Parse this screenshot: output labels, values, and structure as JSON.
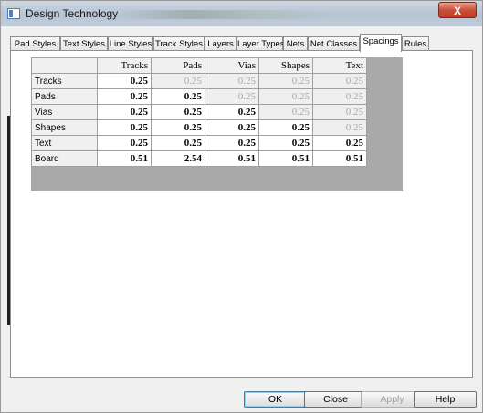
{
  "window": {
    "title": "Design Technology",
    "close_label": "X"
  },
  "tabs": [
    {
      "label": "Pad Styles",
      "active": false
    },
    {
      "label": "Text Styles",
      "active": false
    },
    {
      "label": "Line Styles",
      "active": false
    },
    {
      "label": "Track Styles",
      "active": false
    },
    {
      "label": "Layers",
      "active": false
    },
    {
      "label": "Layer Types",
      "active": false
    },
    {
      "label": "Nets",
      "active": false
    },
    {
      "label": "Net Classes",
      "active": false
    },
    {
      "label": "Spacings",
      "active": true
    },
    {
      "label": "Rules",
      "active": false
    }
  ],
  "spacings": {
    "columns": [
      "Tracks",
      "Pads",
      "Vias",
      "Shapes",
      "Text"
    ],
    "rows": [
      {
        "label": "Tracks",
        "values": [
          "0.25",
          "0.25",
          "0.25",
          "0.25",
          "0.25"
        ]
      },
      {
        "label": "Pads",
        "values": [
          "0.25",
          "0.25",
          "0.25",
          "0.25",
          "0.25"
        ]
      },
      {
        "label": "Vias",
        "values": [
          "0.25",
          "0.25",
          "0.25",
          "0.25",
          "0.25"
        ]
      },
      {
        "label": "Shapes",
        "values": [
          "0.25",
          "0.25",
          "0.25",
          "0.25",
          "0.25"
        ]
      },
      {
        "label": "Text",
        "values": [
          "0.25",
          "0.25",
          "0.25",
          "0.25",
          "0.25"
        ]
      },
      {
        "label": "Board",
        "values": [
          "0.51",
          "2.54",
          "0.51",
          "0.51",
          "0.51"
        ]
      }
    ]
  },
  "buttons": {
    "ok": "OK",
    "close": "Close",
    "apply": "Apply",
    "help": "Help"
  }
}
